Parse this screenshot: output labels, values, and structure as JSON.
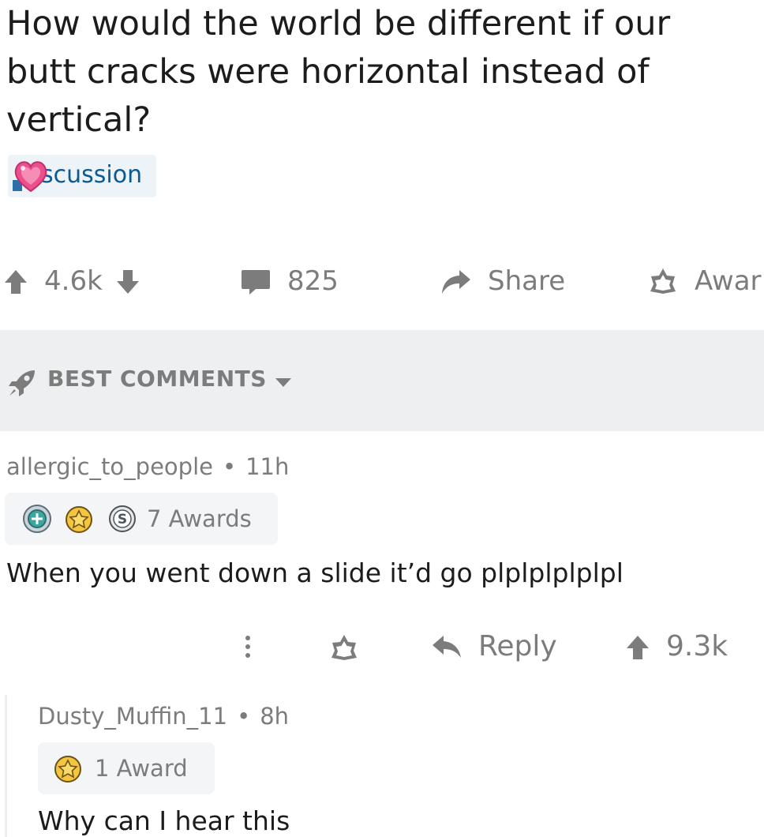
{
  "post": {
    "title_lines": [
      "How would the world be different if our",
      "butt cracks were horizontal instead of",
      "vertical?"
    ],
    "flair": "Discussion",
    "flair_visible": "scussion",
    "votes": "4.6k",
    "comments": "825",
    "share_label": "Share",
    "award_label": "Awar"
  },
  "sort": {
    "label": "BEST COMMENTS"
  },
  "comments": [
    {
      "author": "allergic_to_people",
      "separator": "•",
      "age": "11h",
      "awards": "7 Awards",
      "body": "When you went down a slide it’d go plplplplplpl",
      "more": "⋮",
      "reply_label": "Reply",
      "votes": "9.3k"
    },
    {
      "author": "Dusty_Muffin_11",
      "separator": "•",
      "age": "8h",
      "awards": "1 Award",
      "body": "Why can I hear this"
    }
  ],
  "colors": {
    "meta_gray": "#7c7c7c",
    "bar_bg": "#edeff1",
    "flair_text": "#0a5a94",
    "text": "#1c1c1c"
  }
}
